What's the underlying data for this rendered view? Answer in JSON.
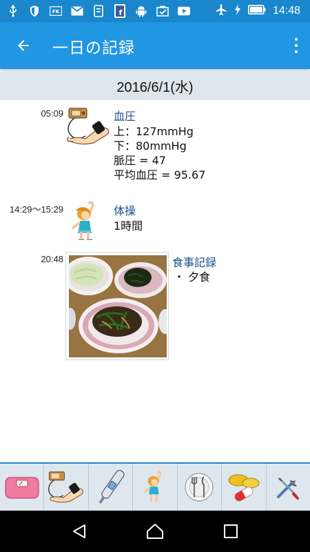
{
  "status_bar": {
    "time": "14:48",
    "icons": [
      "usb-icon",
      "shield-icon",
      "fk-icon",
      "gmail-icon",
      "phone-app-icon",
      "facebook-icon",
      "android-icon",
      "checklist-icon",
      "youtube-icon",
      "airplane-icon",
      "battery-charging-icon",
      "battery-icon"
    ]
  },
  "appbar": {
    "title": "一日の記録"
  },
  "date_header": "2016/6/1(水)",
  "records": [
    {
      "time": "05:09",
      "category": "血圧",
      "icon": "blood-pressure-icon",
      "lines": [
        "上：127mmHg",
        "下：80mmHg",
        "脈圧 = 47",
        "平均血圧 = 95.67"
      ]
    },
    {
      "time": "14:29〜15:29",
      "category": "体操",
      "icon": "exercise-icon",
      "lines": [
        "1時間"
      ]
    },
    {
      "time": "20:48",
      "category": "食事記録",
      "icon": "meal-photo",
      "lines": [
        "・ 夕食"
      ]
    }
  ],
  "toolbar": {
    "items": [
      "scale-icon",
      "blood-pressure-icon",
      "thermometer-icon",
      "exercise-icon",
      "meal-icon",
      "medicine-icon",
      "settings-tools-icon"
    ]
  },
  "colors": {
    "status_bar": "#1a86cc",
    "app_bar": "#2196e3",
    "date_bar": "#dde6ec",
    "category_text": "#1a4f8a"
  }
}
